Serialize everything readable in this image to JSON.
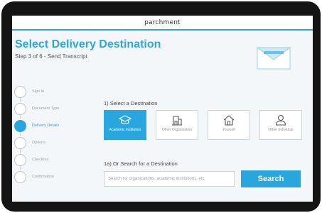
{
  "header": {
    "logo": "parchment"
  },
  "page": {
    "title": "Select Delivery Destination",
    "subtitle": "Step 3 of 6 - Send Transcript"
  },
  "steps": [
    {
      "label": "Sign In",
      "active": false
    },
    {
      "label": "Document Type",
      "active": false
    },
    {
      "label": "Delivery Details",
      "active": true
    },
    {
      "label": "Options",
      "active": false
    },
    {
      "label": "Checkout",
      "active": false
    },
    {
      "label": "Confirmation",
      "active": false
    }
  ],
  "destination": {
    "heading": "1) Select a Destination",
    "options": [
      {
        "label": "Academic Institution",
        "icon": "graduation-cap-icon",
        "selected": true
      },
      {
        "label": "Other Organization",
        "icon": "building-icon",
        "selected": false
      },
      {
        "label": "Yourself",
        "icon": "home-icon",
        "selected": false
      },
      {
        "label": "Other Individual",
        "icon": "person-icon",
        "selected": false
      }
    ]
  },
  "search": {
    "heading": "1a) Or Search for a Destination",
    "placeholder": "Search for organizations, academic institutions, etc",
    "button_label": "Search"
  },
  "colors": {
    "accent": "#2aa6de",
    "device": "#141414"
  }
}
